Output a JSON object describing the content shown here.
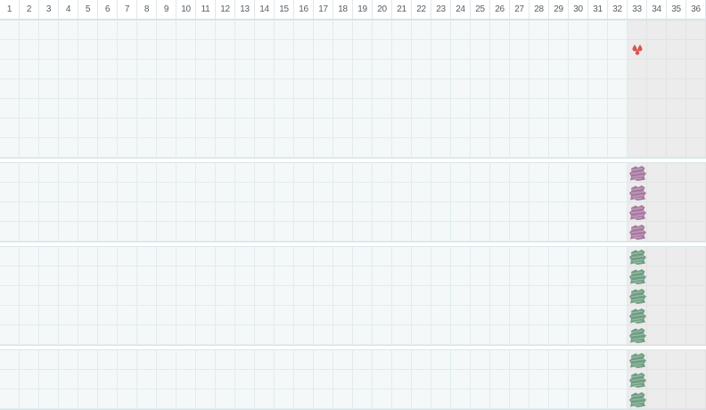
{
  "columns": [
    "1",
    "2",
    "3",
    "4",
    "5",
    "6",
    "7",
    "8",
    "9",
    "10",
    "11",
    "12",
    "13",
    "14",
    "15",
    "16",
    "17",
    "18",
    "19",
    "20",
    "21",
    "22",
    "23",
    "24",
    "25",
    "26",
    "27",
    "28",
    "29",
    "30",
    "31",
    "32",
    "33",
    "34",
    "35",
    "36"
  ],
  "shaded_from_column": 33,
  "colors": {
    "grid_bg": "#f4f8f9",
    "shaded_bg": "#ececec",
    "drop": "#d9534f",
    "purple": "#a77aa0",
    "green": "#6f9e83"
  },
  "sections": [
    {
      "name": "section-1",
      "rows": 7,
      "markers": [
        {
          "row": 2,
          "col": 33,
          "icon": "blood-drops-icon",
          "color": "#d9534f"
        }
      ]
    },
    {
      "name": "section-2",
      "rows": 4,
      "markers": [
        {
          "row": 1,
          "col": 33,
          "icon": "scribble-mark-icon",
          "color": "#a77aa0"
        },
        {
          "row": 2,
          "col": 33,
          "icon": "scribble-mark-icon",
          "color": "#a77aa0"
        },
        {
          "row": 3,
          "col": 33,
          "icon": "scribble-mark-icon",
          "color": "#a77aa0"
        },
        {
          "row": 4,
          "col": 33,
          "icon": "scribble-mark-icon",
          "color": "#a77aa0"
        }
      ]
    },
    {
      "name": "section-3",
      "rows": 5,
      "markers": [
        {
          "row": 1,
          "col": 33,
          "icon": "scribble-mark-icon",
          "color": "#6f9e83"
        },
        {
          "row": 2,
          "col": 33,
          "icon": "scribble-mark-icon",
          "color": "#6f9e83"
        },
        {
          "row": 3,
          "col": 33,
          "icon": "scribble-mark-icon",
          "color": "#6f9e83"
        },
        {
          "row": 4,
          "col": 33,
          "icon": "scribble-mark-icon",
          "color": "#6f9e83"
        },
        {
          "row": 5,
          "col": 33,
          "icon": "scribble-mark-icon",
          "color": "#6f9e83"
        }
      ]
    },
    {
      "name": "section-4",
      "rows": 3,
      "markers": [
        {
          "row": 1,
          "col": 33,
          "icon": "scribble-mark-icon",
          "color": "#6f9e83"
        },
        {
          "row": 2,
          "col": 33,
          "icon": "scribble-mark-icon",
          "color": "#6f9e83"
        },
        {
          "row": 3,
          "col": 33,
          "icon": "scribble-mark-icon",
          "color": "#6f9e83"
        }
      ]
    }
  ]
}
